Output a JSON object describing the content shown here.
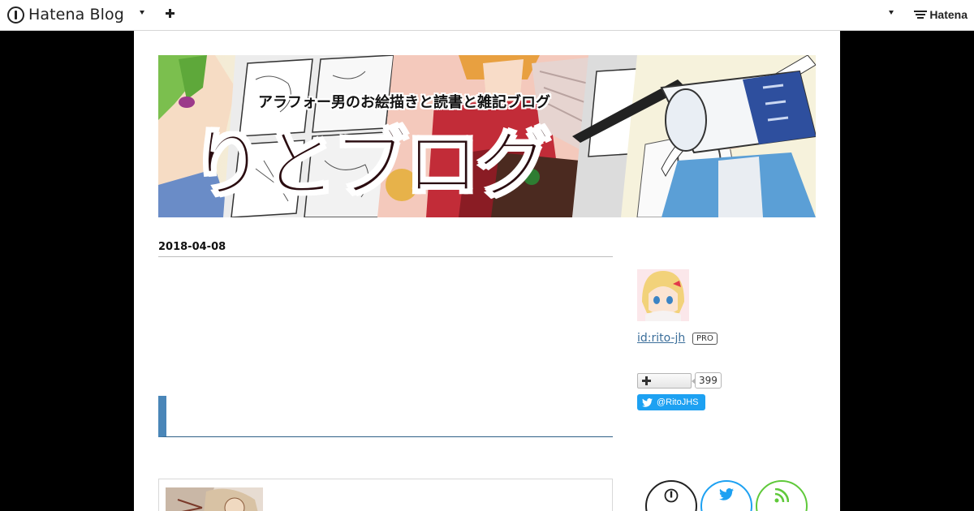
{
  "globalbar": {
    "logo_text": "Hatena Blog",
    "brand_text": "Hatena"
  },
  "blog": {
    "banner_title": "りとブログ",
    "banner_subtitle": "アラフォー男のお絵描きと読書と雑記ブログ"
  },
  "entry": {
    "date": "2018-04-08",
    "accent_color": "#4a86b8"
  },
  "sidebar": {
    "profile_id": "id:rito-jh",
    "pro_badge": "PRO",
    "follower_count": "399",
    "twitter_handle": "@RitoJHS",
    "share_icons": [
      "hatena-icon",
      "twitter-icon",
      "rss-icon"
    ]
  },
  "colors": {
    "twitter": "#1da1f2",
    "rss": "#5fc93a",
    "hatena": "#222222",
    "link": "#3b6e9a"
  }
}
